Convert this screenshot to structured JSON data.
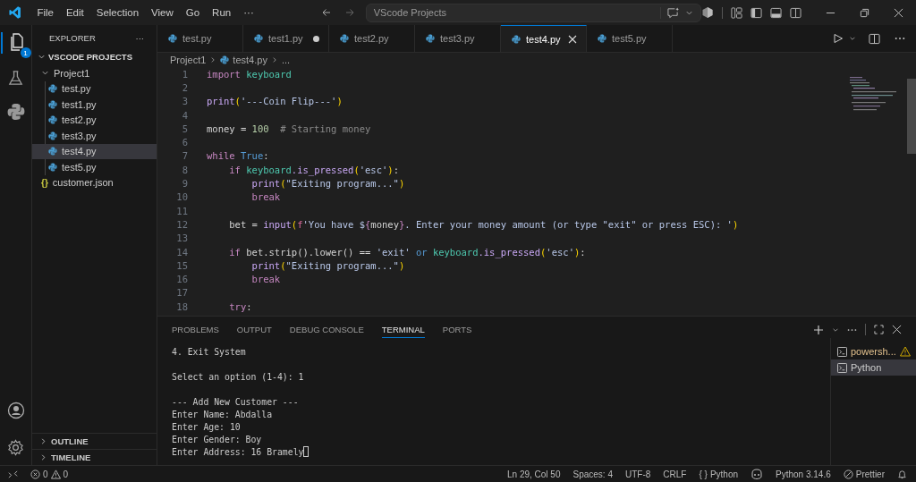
{
  "menu": [
    "File",
    "Edit",
    "Selection",
    "View",
    "Go",
    "Run",
    "···"
  ],
  "search": {
    "value": "VScode Projects"
  },
  "activity": {
    "badge": "1"
  },
  "explorer": {
    "title": "EXPLORER",
    "more": "···",
    "root": {
      "label": "VSCODE PROJECTS",
      "expanded": true,
      "children": [
        {
          "label": "Project1",
          "kind": "folder",
          "expanded": true,
          "selected": false,
          "children": [
            {
              "label": "test.py",
              "kind": "py",
              "selected": false
            },
            {
              "label": "test1.py",
              "kind": "py",
              "selected": false
            },
            {
              "label": "test2.py",
              "kind": "py",
              "selected": false
            },
            {
              "label": "test3.py",
              "kind": "py",
              "selected": false
            },
            {
              "label": "test4.py",
              "kind": "py",
              "selected": true
            },
            {
              "label": "test5.py",
              "kind": "py",
              "selected": false
            }
          ]
        },
        {
          "label": "customer.json",
          "kind": "json",
          "icon": "{}",
          "selected": false
        }
      ]
    },
    "sections": [
      {
        "label": "OUTLINE",
        "expanded": false
      },
      {
        "label": "TIMELINE",
        "expanded": false
      }
    ]
  },
  "tabs": [
    {
      "label": "test.py",
      "selected": false,
      "modified": false
    },
    {
      "label": "test1.py",
      "selected": false,
      "modified": true
    },
    {
      "label": "test2.py",
      "selected": false,
      "modified": false
    },
    {
      "label": "test3.py",
      "selected": false,
      "modified": false
    },
    {
      "label": "test4.py",
      "selected": true,
      "modified": false
    },
    {
      "label": "test5.py",
      "selected": false,
      "modified": false
    }
  ],
  "breadcrumb": {
    "folder": "Project1",
    "file": "test4.py",
    "rest": "..."
  },
  "code": [
    {
      "n": "1",
      "tokens": [
        {
          "t": "import ",
          "kind": "kw"
        },
        {
          "t": "keyboard",
          "kind": "mod"
        }
      ]
    },
    {
      "n": "2"
    },
    {
      "n": "3",
      "tokens": [
        {
          "t": "print",
          "kind": "fn"
        },
        {
          "t": "(",
          "kind": "br"
        },
        {
          "t": "'---Coin Flip---'",
          "kind": "str"
        },
        {
          "t": ")",
          "kind": "br"
        }
      ]
    },
    {
      "n": "4"
    },
    {
      "n": "5",
      "tokens": [
        {
          "t": "money = ",
          "kind": "plain"
        },
        {
          "t": "100",
          "kind": "num"
        },
        {
          "t": "  # Starting money",
          "kind": "cmt"
        }
      ]
    },
    {
      "n": "6"
    },
    {
      "n": "7",
      "tokens": [
        {
          "t": "while ",
          "kind": "kw"
        },
        {
          "t": "True",
          "kind": "const"
        },
        {
          "t": ":",
          "kind": "plain"
        }
      ]
    },
    {
      "n": "8",
      "tokens": [
        {
          "t": "    if ",
          "kind": "kw"
        },
        {
          "t": "keyboard",
          "kind": "mod"
        },
        {
          "t": ".is_pressed",
          "kind": "fn"
        },
        {
          "t": "(",
          "kind": "br"
        },
        {
          "t": "'esc'",
          "kind": "str"
        },
        {
          "t": ")",
          "kind": "br"
        },
        {
          "t": ":",
          "kind": "plain"
        }
      ]
    },
    {
      "n": "9",
      "tokens": [
        {
          "t": "        print",
          "kind": "fn"
        },
        {
          "t": "(",
          "kind": "br"
        },
        {
          "t": "\"Exiting program...\"",
          "kind": "str"
        },
        {
          "t": ")",
          "kind": "br"
        }
      ]
    },
    {
      "n": "10",
      "tokens": [
        {
          "t": "        break",
          "kind": "kw"
        }
      ]
    },
    {
      "n": "11"
    },
    {
      "n": "12",
      "tokens": [
        {
          "t": "    bet = ",
          "kind": "plain"
        },
        {
          "t": "input",
          "kind": "fn"
        },
        {
          "t": "(",
          "kind": "br"
        },
        {
          "t": "f",
          "kind": "fmt"
        },
        {
          "t": "'You have $",
          "kind": "str"
        },
        {
          "t": "{",
          "kind": "brace"
        },
        {
          "t": "money",
          "kind": "plain"
        },
        {
          "t": "}",
          "kind": "brace"
        },
        {
          "t": ". Enter your money amount (or type \"exit\" or press ESC): '",
          "kind": "str"
        },
        {
          "t": ")",
          "kind": "br"
        }
      ]
    },
    {
      "n": "13"
    },
    {
      "n": "14",
      "tokens": [
        {
          "t": "    if",
          "kind": "kw"
        },
        {
          "t": " bet.strip().lower() == ",
          "kind": "plain"
        },
        {
          "t": "'exit' ",
          "kind": "str"
        },
        {
          "t": "or ",
          "kind": "const"
        },
        {
          "t": "keyboard",
          "kind": "mod"
        },
        {
          "t": ".is_pressed",
          "kind": "fn"
        },
        {
          "t": "(",
          "kind": "br"
        },
        {
          "t": "'esc'",
          "kind": "str"
        },
        {
          "t": ")",
          "kind": "br"
        },
        {
          "t": ":",
          "kind": "plain"
        }
      ]
    },
    {
      "n": "15",
      "tokens": [
        {
          "t": "        print",
          "kind": "fn"
        },
        {
          "t": "(",
          "kind": "br"
        },
        {
          "t": "\"Exiting program...\"",
          "kind": "str"
        },
        {
          "t": ")",
          "kind": "br"
        }
      ]
    },
    {
      "n": "16",
      "tokens": [
        {
          "t": "        break",
          "kind": "kw"
        }
      ]
    },
    {
      "n": "17"
    },
    {
      "n": "18",
      "tokens": [
        {
          "t": "    try",
          "kind": "kw"
        },
        {
          "t": ":",
          "kind": "plain"
        }
      ]
    }
  ],
  "panel_tabs": [
    {
      "label": "PROBLEMS",
      "selected": false
    },
    {
      "label": "OUTPUT",
      "selected": false
    },
    {
      "label": "DEBUG CONSOLE",
      "selected": false
    },
    {
      "label": "TERMINAL",
      "selected": true
    },
    {
      "label": "PORTS",
      "selected": false
    }
  ],
  "terminal": [
    {
      "lines": [
        "4. Exit System"
      ]
    },
    {
      "lines": [
        "Select an option (1-4): 1"
      ]
    },
    {
      "lines": [
        "--- Add New Customer ---",
        "Enter Name: Abdalla",
        "Enter Age: 10",
        "Enter Gender: Boy",
        "Enter Address: 16 Bramely"
      ]
    }
  ],
  "terminals": [
    {
      "label": "powersh...",
      "warning": true,
      "selected": false
    },
    {
      "label": "Python",
      "warning": false,
      "selected": true
    }
  ],
  "status": {
    "errors": "0",
    "warnings": "0",
    "right": [
      {
        "kind": "text",
        "label": "Ln 29, Col 50"
      },
      {
        "kind": "text",
        "label": "Spaces: 4"
      },
      {
        "kind": "text",
        "label": "UTF-8"
      },
      {
        "kind": "text",
        "label": "CRLF"
      },
      {
        "kind": "lang",
        "glyph": "{ }",
        "label": "Python"
      },
      {
        "kind": "copilot"
      },
      {
        "kind": "text",
        "label": "Python 3.14.6"
      },
      {
        "kind": "prettier",
        "label": "Prettier"
      },
      {
        "kind": "bell"
      }
    ]
  }
}
